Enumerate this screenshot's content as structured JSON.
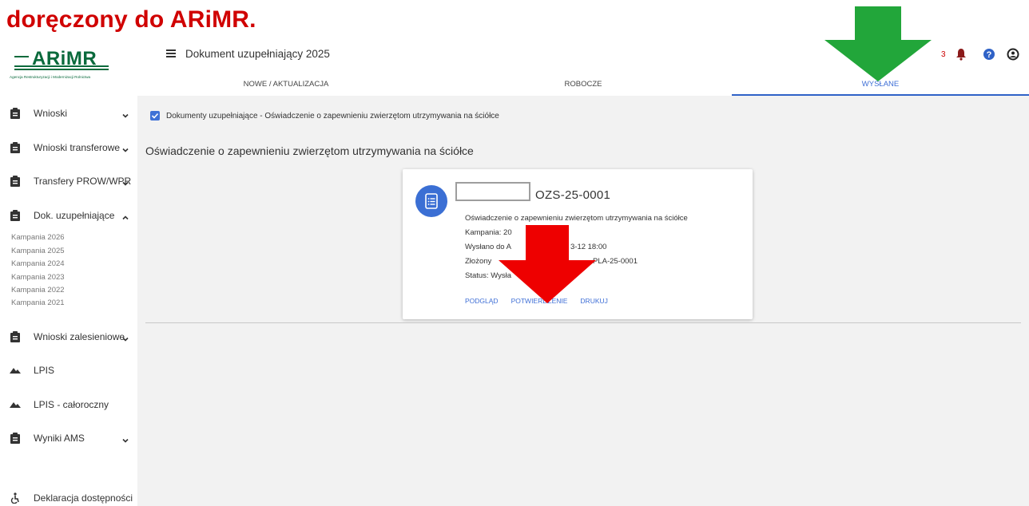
{
  "caption": {
    "text": "doręczony do ARiMR."
  },
  "logo": {
    "name": "ARiMR",
    "subtitle": "Agencja Restrukturyzacji i Modernizacji Rolnictwa"
  },
  "header": {
    "title": "Dokument uzupełniający 2025",
    "notification_count": "3",
    "icons": [
      "bell-icon",
      "help-icon",
      "account-icon"
    ]
  },
  "tabs": [
    {
      "label": "NOWE / AKTUALIZACJA",
      "active": false
    },
    {
      "label": "ROBOCZE",
      "active": false
    },
    {
      "label": "WYSŁANE",
      "active": true
    }
  ],
  "sidebar": {
    "items": [
      {
        "label": "Wnioski",
        "icon": "clipboard-icon",
        "expandable": true
      },
      {
        "label": "Wnioski transferowe",
        "icon": "clipboard-icon",
        "expandable": true
      },
      {
        "label": "Transfery PROW/WPR",
        "icon": "clipboard-icon",
        "expandable": true
      },
      {
        "label": "Dok. uzupełniające",
        "icon": "clipboard-icon",
        "expandable": true,
        "expanded": true
      },
      {
        "label": "Wnioski zalesieniowe",
        "icon": "clipboard-icon",
        "expandable": true
      },
      {
        "label": "LPIS",
        "icon": "mountain-icon",
        "expandable": false
      },
      {
        "label": "LPIS - całoroczny",
        "icon": "mountain-icon",
        "expandable": false
      },
      {
        "label": "Wyniki AMS",
        "icon": "clipboard-icon",
        "expandable": true
      },
      {
        "label": "Deklaracja dostępności",
        "icon": "accessibility-icon",
        "expandable": false
      }
    ],
    "subitems": [
      "Kampania 2026",
      "Kampania 2025",
      "Kampania 2024",
      "Kampania 2023",
      "Kampania 2022",
      "Kampania 2021"
    ]
  },
  "main": {
    "filter": {
      "label": "Dokumenty uzupełniające - Oświadczenie o zapewnieniu zwierzętom utrzymywania na ściółce",
      "checked": true
    },
    "section_title": "Oświadczenie o zapewnieniu zwierzętom utrzymywania na ściółce"
  },
  "card": {
    "id": "OZS-25-0001",
    "lines": [
      "Oświadczenie o zapewnieniu zwierzętom utrzymywania na ściółce",
      "Kampania: 20",
      "Wysłano do A",
      "3-12 18:00",
      "Złożony",
      "PLA-25-0001",
      "Status: Wysła"
    ],
    "actions": [
      "PODGLĄD",
      "POTWIERDZENIE",
      "DRUKUJ"
    ]
  },
  "colors": {
    "accent": "#3f6fd6",
    "brand": "#0a6a3c",
    "caption": "#d00000",
    "arrow_green": "#22a63a",
    "arrow_red": "#ee0000"
  }
}
